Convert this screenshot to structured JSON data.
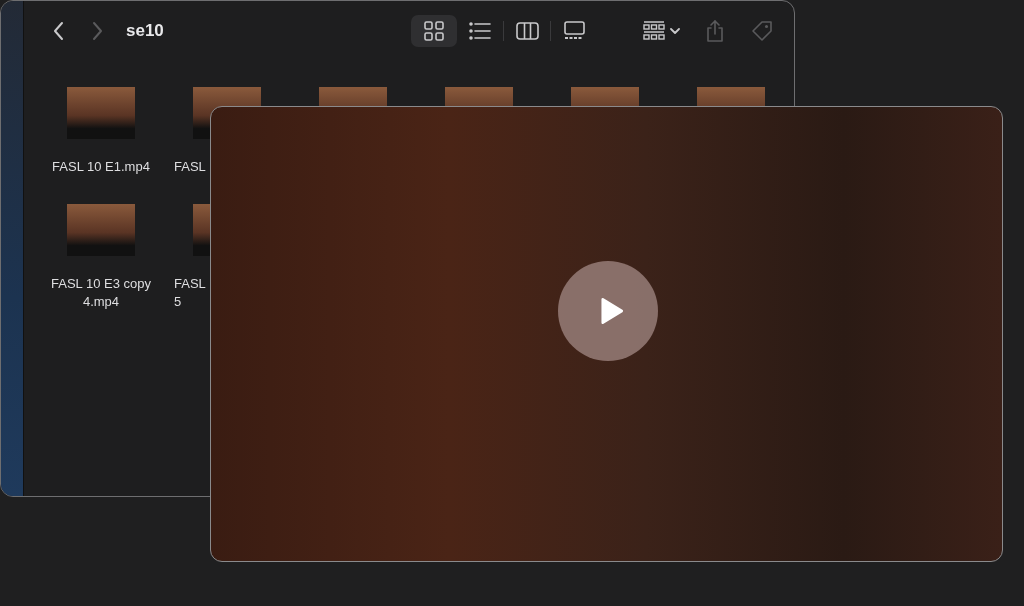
{
  "window": {
    "title": "se10"
  },
  "navigation": [
    {
      "kind": "back",
      "disabled": false
    },
    {
      "kind": "forward",
      "disabled": true
    }
  ],
  "view_modes": [
    {
      "kind": "icons",
      "selected": true
    },
    {
      "kind": "list",
      "selected": false
    },
    {
      "kind": "columns",
      "selected": false
    },
    {
      "kind": "gallery",
      "selected": false
    }
  ],
  "toolbar_actions": [
    {
      "kind": "group",
      "disabled": false
    },
    {
      "kind": "share",
      "disabled": true
    },
    {
      "kind": "tags",
      "disabled": true
    }
  ],
  "file_rows": [
    [
      {
        "label_lines": [
          "FASL 10 E1.mp4"
        ],
        "cut": false
      },
      {
        "label_lines": [
          "FASL"
        ],
        "cut": true
      },
      {},
      {},
      {},
      {}
    ],
    [
      {
        "label_lines": [
          "FASL 10 E3 copy",
          "4.mp4"
        ],
        "cut": false
      },
      {
        "label_lines": [
          "FASL",
          "5"
        ],
        "cut": true
      }
    ]
  ]
}
